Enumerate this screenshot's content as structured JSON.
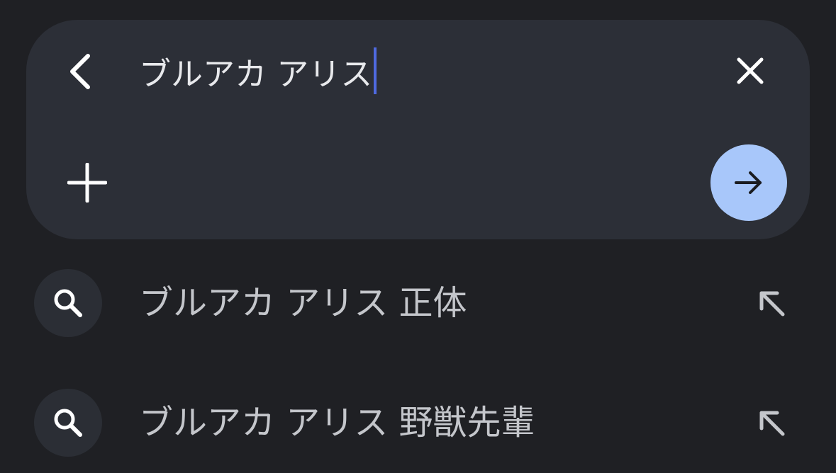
{
  "search": {
    "query": "ブルアカ アリス",
    "back_icon": "chevron-left-icon",
    "clear_icon": "close-icon",
    "add_icon": "plus-icon",
    "submit_icon": "arrow-right-icon"
  },
  "suggestions": [
    {
      "label": "ブルアカ アリス 正体",
      "icon": "search-icon",
      "action_icon": "arrow-up-left-icon"
    },
    {
      "label": "ブルアカ アリス 野獣先輩",
      "icon": "search-icon",
      "action_icon": "arrow-up-left-icon"
    }
  ],
  "colors": {
    "background": "#1f2024",
    "card": "#2c2f37",
    "accent": "#a8c7fa",
    "caret": "#4f6ae0",
    "text_primary": "#e8e9ec",
    "text_secondary": "#c4c6cb"
  }
}
